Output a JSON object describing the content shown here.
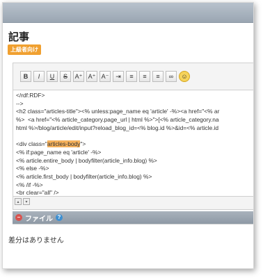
{
  "page": {
    "title": "記事",
    "badge": "上級者向け"
  },
  "toolbar": {
    "buttons": [
      {
        "name": "bold-button",
        "glyph": "B"
      },
      {
        "name": "italic-button",
        "glyph": "I"
      },
      {
        "name": "underline-button",
        "glyph": "U"
      },
      {
        "name": "strikethrough-button",
        "glyph": "S"
      },
      {
        "name": "font-size-up-button",
        "glyph": "A⁺"
      },
      {
        "name": "superscript-button",
        "glyph": "A⁺"
      },
      {
        "name": "subscript-button",
        "glyph": "A⁻"
      },
      {
        "name": "indent-button",
        "glyph": "⇥"
      },
      {
        "name": "align-left-button",
        "glyph": "≡"
      },
      {
        "name": "align-center-button",
        "glyph": "≡"
      },
      {
        "name": "align-right-button",
        "glyph": "≡"
      },
      {
        "name": "link-button",
        "glyph": "∞"
      },
      {
        "name": "emoticon-button",
        "glyph": "☺"
      }
    ]
  },
  "editor": {
    "lines": [
      "</rdf:RDF>",
      "-->",
      "<h2 class=\"articles-title\"><% unless:page_name eq 'article' -%><a href=\"<% ar",
      "%>  <a href=\"<% article_category.page_url | html %>\">[<% article_category.na",
      "html %>/blog/article/edit/input?reload_blog_id=<% blog.id %>&id=<% article.id",
      "",
      "<div class=\"",
      "<% if:page_name eq 'article' -%>",
      "<% article.entire_body | bodyfilter(article_info.blog) %>",
      "<% else -%>",
      "<% article.first_body | bodyfilter(article_info.blog) %>",
      "<% /if -%>",
      "<br clear=\"all\" />"
    ],
    "highlight": "articles-body",
    "highlight_suffix": "\">"
  },
  "file_section": {
    "label": "ファイル"
  },
  "diff": {
    "message": "差分はありません"
  },
  "colors": {
    "badge": "#f0a030",
    "highlight": "#f6b25c",
    "section_bar": "#9aa6b2"
  }
}
